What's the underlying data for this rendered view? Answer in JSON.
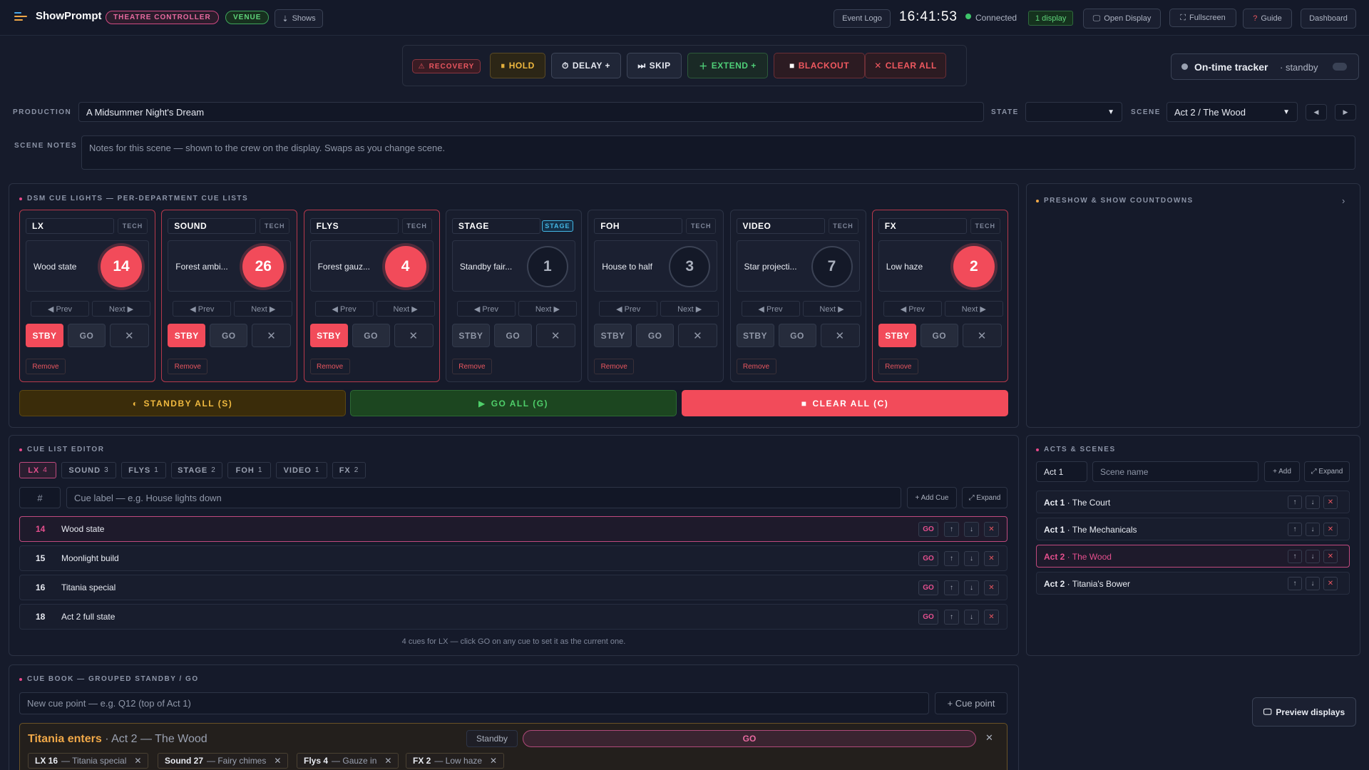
{
  "header": {
    "brand": "ShowPrompt",
    "badge_controller": "THEATRE CONTROLLER",
    "badge_venue": "VENUE",
    "shows_label": "Shows",
    "event_logo_label": "Event Logo",
    "clock": "16:41:53",
    "connection": "Connected",
    "display_count": "1 display",
    "open_display_label": "Open Display",
    "fullscreen_label": "Fullscreen",
    "guide_label": "Guide",
    "dashboard_label": "Dashboard"
  },
  "toolbar": {
    "recovery": "RECOVERY",
    "hold": "HOLD",
    "delay": "DELAY +",
    "skip": "SKIP",
    "extend": "EXTEND +",
    "blackout": "BLACKOUT",
    "clear_all": "CLEAR ALL"
  },
  "tracker": {
    "label": "On-time tracker",
    "status": "· standby"
  },
  "production": {
    "label": "PRODUCTION",
    "value": "A Midsummer Night's Dream",
    "state_label": "STATE",
    "state_value": "",
    "scene_label": "SCENE",
    "scene_value": "Act 2 / The Wood"
  },
  "notes": {
    "label": "SCENE NOTES",
    "placeholder": "Notes for this scene — shown to the crew on the display. Swaps as you change scene."
  },
  "cue_lights": {
    "title": "DSM CUE LIGHTS — PER-DEPARTMENT CUE LISTS",
    "prev_label": "◀ Prev",
    "next_label": "Next ▶",
    "stby_label": "STBY",
    "go_label": "GO",
    "remove_label": "Remove",
    "departments": [
      {
        "name": "LX",
        "tag": "TECH",
        "cue_label": "Wood state",
        "cue_number": "14",
        "standby": true
      },
      {
        "name": "SOUND",
        "tag": "TECH",
        "cue_label": "Forest ambi...",
        "cue_number": "26",
        "standby": true
      },
      {
        "name": "FLYS",
        "tag": "TECH",
        "cue_label": "Forest gauz...",
        "cue_number": "4",
        "standby": true
      },
      {
        "name": "STAGE",
        "tag": "STAGE",
        "cue_label": "Standby fair...",
        "cue_number": "1",
        "standby": false
      },
      {
        "name": "FOH",
        "tag": "TECH",
        "cue_label": "House to half",
        "cue_number": "3",
        "standby": false
      },
      {
        "name": "VIDEO",
        "tag": "TECH",
        "cue_label": "Star projecti...",
        "cue_number": "7",
        "standby": false
      },
      {
        "name": "FX",
        "tag": "TECH",
        "cue_label": "Low haze",
        "cue_number": "2",
        "standby": true
      }
    ],
    "standby_all": "STANDBY ALL (S)",
    "go_all": "GO ALL (G)",
    "clear_all": "CLEAR ALL (C)"
  },
  "countdowns": {
    "title": "PRESHOW & SHOW COUNTDOWNS"
  },
  "cue_editor": {
    "title": "CUE LIST EDITOR",
    "tabs": [
      {
        "label": "LX",
        "count": "4"
      },
      {
        "label": "SOUND",
        "count": "3"
      },
      {
        "label": "FLYS",
        "count": "1"
      },
      {
        "label": "STAGE",
        "count": "2"
      },
      {
        "label": "FOH",
        "count": "1"
      },
      {
        "label": "VIDEO",
        "count": "1"
      },
      {
        "label": "FX",
        "count": "2"
      }
    ],
    "number_placeholder": "#",
    "label_placeholder": "Cue label — e.g. House lights down",
    "add_cue": "+ Add Cue",
    "expand": "⤢ Expand",
    "go_label": "GO",
    "cues": [
      {
        "number": "14",
        "label": "Wood state"
      },
      {
        "number": "15",
        "label": "Moonlight build"
      },
      {
        "number": "16",
        "label": "Titania special"
      },
      {
        "number": "18",
        "label": "Act 2 full state"
      }
    ],
    "footer": "4 cues for LX — click GO on any cue to set it as the current one."
  },
  "acts": {
    "title": "ACTS & SCENES",
    "act_value": "Act 1",
    "scene_placeholder": "Scene name",
    "add": "+ Add",
    "expand": "⤢ Expand",
    "scenes": [
      {
        "act": "Act 1",
        "scene": " · The Court"
      },
      {
        "act": "Act 1",
        "scene": " · The Mechanicals"
      },
      {
        "act": "Act 2",
        "scene": " · The Wood"
      },
      {
        "act": "Act 2",
        "scene": " · Titania's Bower"
      }
    ]
  },
  "cue_book": {
    "title": "CUE BOOK — GROUPED STANDBY / GO",
    "placeholder": "New cue point — e.g. Q12 (top of Act 1)",
    "add_point": "+ Cue point",
    "group": {
      "title": "Titania enters",
      "subtitle": " · Act 2 — The Wood",
      "standby": "Standby",
      "go": "GO",
      "chips": [
        {
          "dept": "LX 16",
          "label": " — Titania special"
        },
        {
          "dept": "Sound 27",
          "label": " — Fairy chimes"
        },
        {
          "dept": "Flys 4",
          "label": " — Gauze in"
        },
        {
          "dept": "FX 2",
          "label": " — Low haze"
        }
      ]
    }
  },
  "preview_displays": "Preview displays",
  "colors": {
    "accent_pink": "#e54f8e",
    "standby_red": "#f24b5a",
    "gold": "#f0a848",
    "go_green": "#1e4a22",
    "standby_amber": "#3c2e0c"
  }
}
